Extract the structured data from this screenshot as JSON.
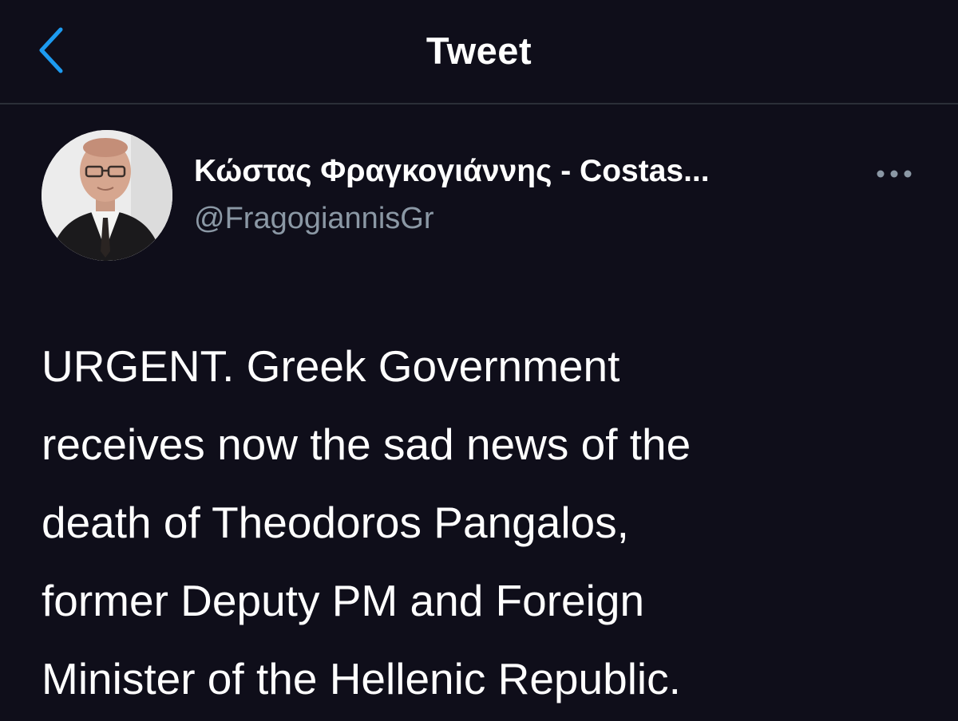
{
  "header": {
    "back_icon": "chevron-left-icon",
    "title": "Tweet"
  },
  "author": {
    "avatar_icon": "profile-photo",
    "display_name": "Κώστας Φραγκογιάννης - Costas...",
    "handle": "@FragogiannisGr"
  },
  "more_icon": "more-horizontal-icon",
  "tweet": {
    "lines": [
      "URGENT. Greek Government",
      "receives now the sad news of the",
      "death of Theodoros Pangalos,",
      "former Deputy PM and Foreign",
      "Minister of the Hellenic Republic."
    ]
  },
  "colors": {
    "background": "#0f0e1a",
    "accent": "#1d9bf0",
    "secondary_text": "#8b98a5",
    "divider": "#2b2f38"
  }
}
